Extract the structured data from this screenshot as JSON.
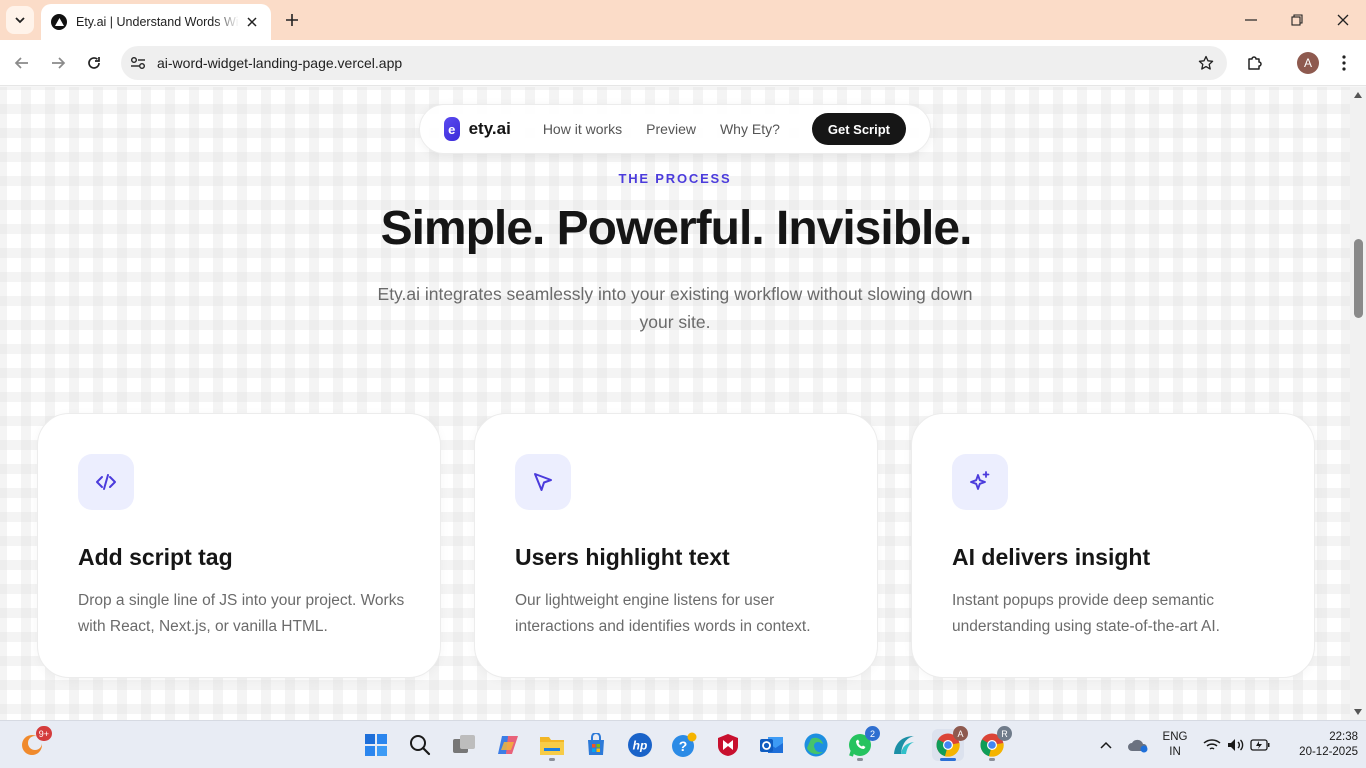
{
  "browser": {
    "tab_title": "Ety.ai | Understand Words With AI",
    "url": "ai-word-widget-landing-page.vercel.app",
    "profile_initial": "A"
  },
  "site": {
    "brand_mark": "e",
    "brand_name": "ety.ai",
    "nav_links": [
      "How it works",
      "Preview",
      "Why Ety?"
    ],
    "cta": "Get Script"
  },
  "section": {
    "eyebrow": "THE PROCESS",
    "headline": "Simple. Powerful. Invisible.",
    "subhead": "Ety.ai integrates seamlessly into your existing workflow without slowing down your site."
  },
  "cards": [
    {
      "icon": "code-icon",
      "title": "Add script tag",
      "desc": "Drop a single line of JS into your project. Works with React, Next.js, or vanilla HTML."
    },
    {
      "icon": "cursor-icon",
      "title": "Users highlight text",
      "desc": "Our lightweight engine listens for user interactions and identifies words in context."
    },
    {
      "icon": "sparkles-icon",
      "title": "AI delivers insight",
      "desc": "Instant popups provide deep semantic understanding using state-of-the-art AI."
    }
  ],
  "taskbar": {
    "weather_badge": "9+",
    "whatsapp_badge": "2",
    "chrome_profile_1": "A",
    "chrome_profile_2": "R",
    "lang_1": "ENG",
    "lang_2": "IN",
    "time": "22:38",
    "date": "20-12-2025"
  },
  "colors": {
    "accent": "#4b3bdc",
    "tabbar": "#fbdcc8",
    "cta_bg": "#161616"
  }
}
